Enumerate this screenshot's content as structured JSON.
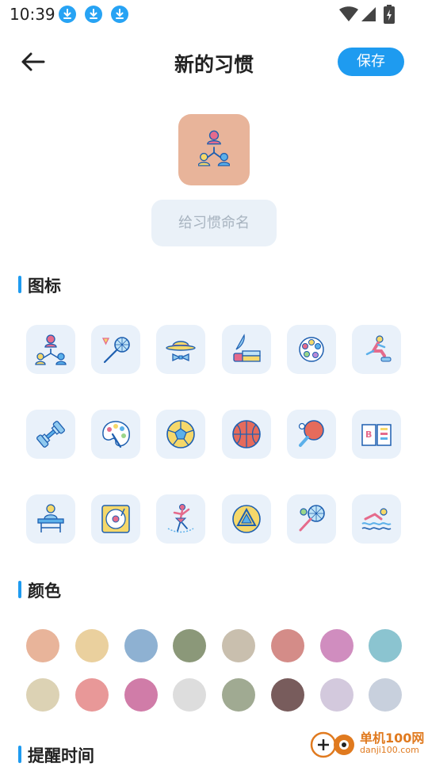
{
  "status_bar": {
    "time": "10:39",
    "download_icons": [
      "download-icon",
      "download-icon",
      "download-icon"
    ]
  },
  "header": {
    "back_icon": "arrow-left-icon",
    "title": "新的习惯",
    "save_label": "保存",
    "accent": "#1e9bf0"
  },
  "preview": {
    "icon": "team-hierarchy-icon",
    "background": "#e8b49a"
  },
  "name_input": {
    "value": "",
    "placeholder": "给习惯命名"
  },
  "icons_section": {
    "title": "图标",
    "icons": [
      "team-hierarchy-icon",
      "badminton-icon",
      "hat-bowtie-icon",
      "ink-quill-books-icon",
      "palette-dots-icon",
      "runner-icon",
      "dumbbell-icon",
      "paint-palette-icon",
      "volleyball-icon",
      "basketball-icon",
      "ping-pong-icon",
      "open-book-icon",
      "student-desk-icon",
      "vinyl-record-icon",
      "ballerina-icon",
      "triangle-ball-icon",
      "tennis-racket-icon",
      "swimmer-icon"
    ]
  },
  "colors_section": {
    "title": "颜色",
    "colors": [
      "#e8b49a",
      "#ead09e",
      "#8eb1d2",
      "#8b9879",
      "#c9bfae",
      "#d48c88",
      "#d08dbf",
      "#8bc4d0",
      "#dcd2b4",
      "#e89898",
      "#d07ca8",
      "#dddddd",
      "#a0aa92",
      "#785c5c",
      "#d3c9dd",
      "#c8d0dd"
    ]
  },
  "reminder_section": {
    "title": "提醒时间"
  },
  "watermark": {
    "name": "单机100网",
    "url": "danji100.com"
  }
}
